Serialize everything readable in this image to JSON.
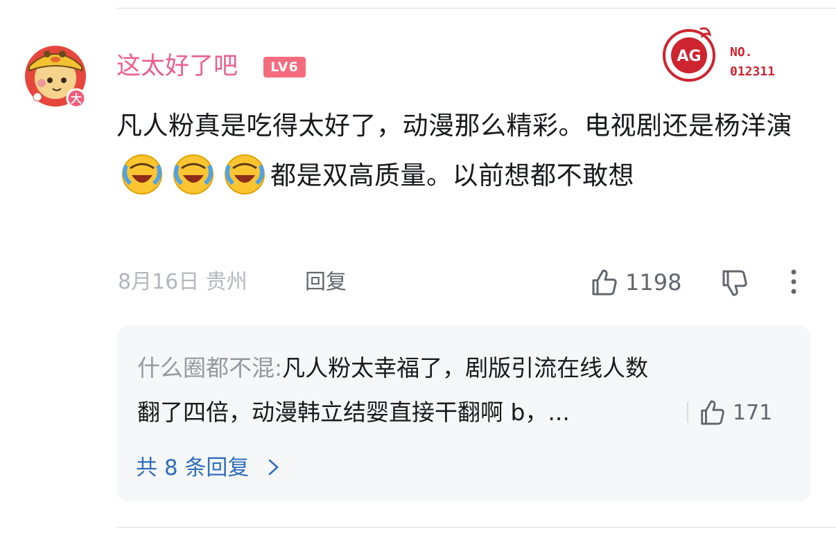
{
  "comment": {
    "username": "这太好了吧",
    "level": "LV6",
    "badge_no_label": "NO.",
    "badge_number": "012311",
    "badge_text": "AG",
    "text_part1": "凡人粉真是吃得太好了，动漫那么精彩。电视剧还是杨洋演",
    "text_part2": "都是双高质量。以前想都不敢想",
    "avatar_badge": "大",
    "date": "8月16日",
    "location": "贵州",
    "reply_label": "回复",
    "like_count": "1198"
  },
  "sub_reply": {
    "username": "什么圈都不混:",
    "text_line1": "凡人粉太幸福了，剧版引流在线人数",
    "text_line2": "翻了四倍，动漫韩立结婴直接干翻啊 b，...",
    "like_count": "171",
    "total_label": "共 8 条回复"
  },
  "colors": {
    "username": "#ee5e8d",
    "level_bg": "#f56c7e",
    "link": "#2f6fbd",
    "badge_red": "#ce2430"
  },
  "icons": [
    "thumb-up-icon",
    "thumb-down-icon",
    "more-vertical-icon",
    "chevron-right-icon",
    "laughing-crying-emoji"
  ]
}
